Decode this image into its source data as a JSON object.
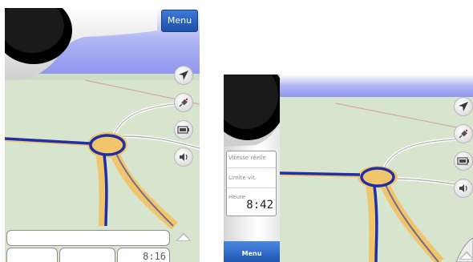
{
  "screen_a": {
    "menu_label": "Menu",
    "time": "8:16",
    "icons": [
      "navigation-arrow-icon",
      "satellite-icon",
      "battery-icon",
      "speaker-icon",
      "expand-up-icon"
    ]
  },
  "screen_b": {
    "menu_label": "Menu",
    "fields": {
      "speed_label": "Vitesse réelle",
      "limit_label": "Limite vit.",
      "time_label": "Heure",
      "time": "8:42"
    },
    "icons": [
      "navigation-arrow-icon",
      "satellite-icon",
      "battery-icon",
      "speaker-icon",
      "expand-up-icon"
    ]
  },
  "colors": {
    "route": "#1f2fa8",
    "road": "#f5c96a",
    "map_ground": "#d7e5cf",
    "sky": "#8f96ec",
    "menu_button": "#2a62c4"
  }
}
